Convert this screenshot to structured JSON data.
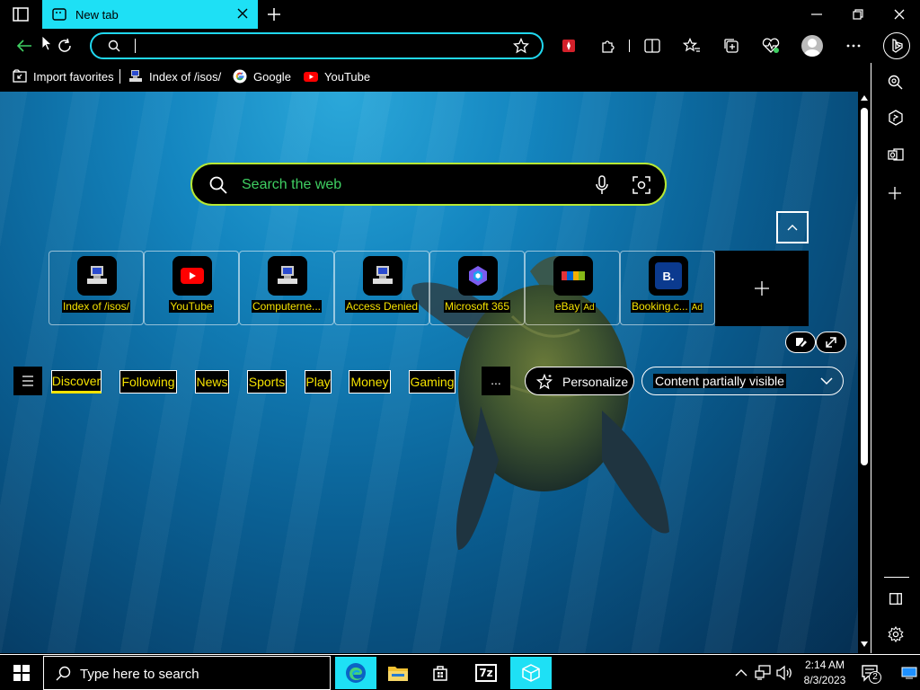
{
  "browser": {
    "tab_title": "New tab",
    "address_value": ""
  },
  "favorites": [
    {
      "label": "Import favorites",
      "icon": "import-icon"
    },
    {
      "label": "Index of /isos/",
      "icon": "computer-icon"
    },
    {
      "label": "Google",
      "icon": "google-icon"
    },
    {
      "label": "YouTube",
      "icon": "youtube-icon"
    }
  ],
  "newtab": {
    "search_placeholder": "Search the web",
    "tiles": [
      {
        "label": "Index of /isos/",
        "icon": "computer-icon",
        "ad": ""
      },
      {
        "label": "YouTube",
        "icon": "youtube-icon",
        "ad": ""
      },
      {
        "label": "Computerne...",
        "icon": "computer-icon",
        "ad": ""
      },
      {
        "label": "Access Denied",
        "icon": "computer-icon",
        "ad": ""
      },
      {
        "label": "Microsoft 365",
        "icon": "microsoft365-icon",
        "ad": ""
      },
      {
        "label": "eBay",
        "icon": "ebay-icon",
        "ad": "Ad"
      },
      {
        "label": "Booking.c...",
        "icon": "booking-icon",
        "ad": "Ad",
        "icon_text": "B."
      }
    ],
    "feed_tabs": [
      "Discover",
      "Following",
      "News",
      "Sports",
      "Play",
      "Money",
      "Gaming"
    ],
    "more_label": "...",
    "personalize_label": "Personalize",
    "content_visibility": "Content partially visible"
  },
  "taskbar": {
    "search_placeholder": "Type here to search",
    "time": "2:14 AM",
    "date": "8/3/2023",
    "notification_count": "2",
    "sevenzip_label": "7z"
  },
  "colors": {
    "accent_cyan": "#1ee0f5",
    "highlight_yellow": "#f5e200",
    "search_border": "#b7e834",
    "placeholder_green": "#3fcf62"
  }
}
